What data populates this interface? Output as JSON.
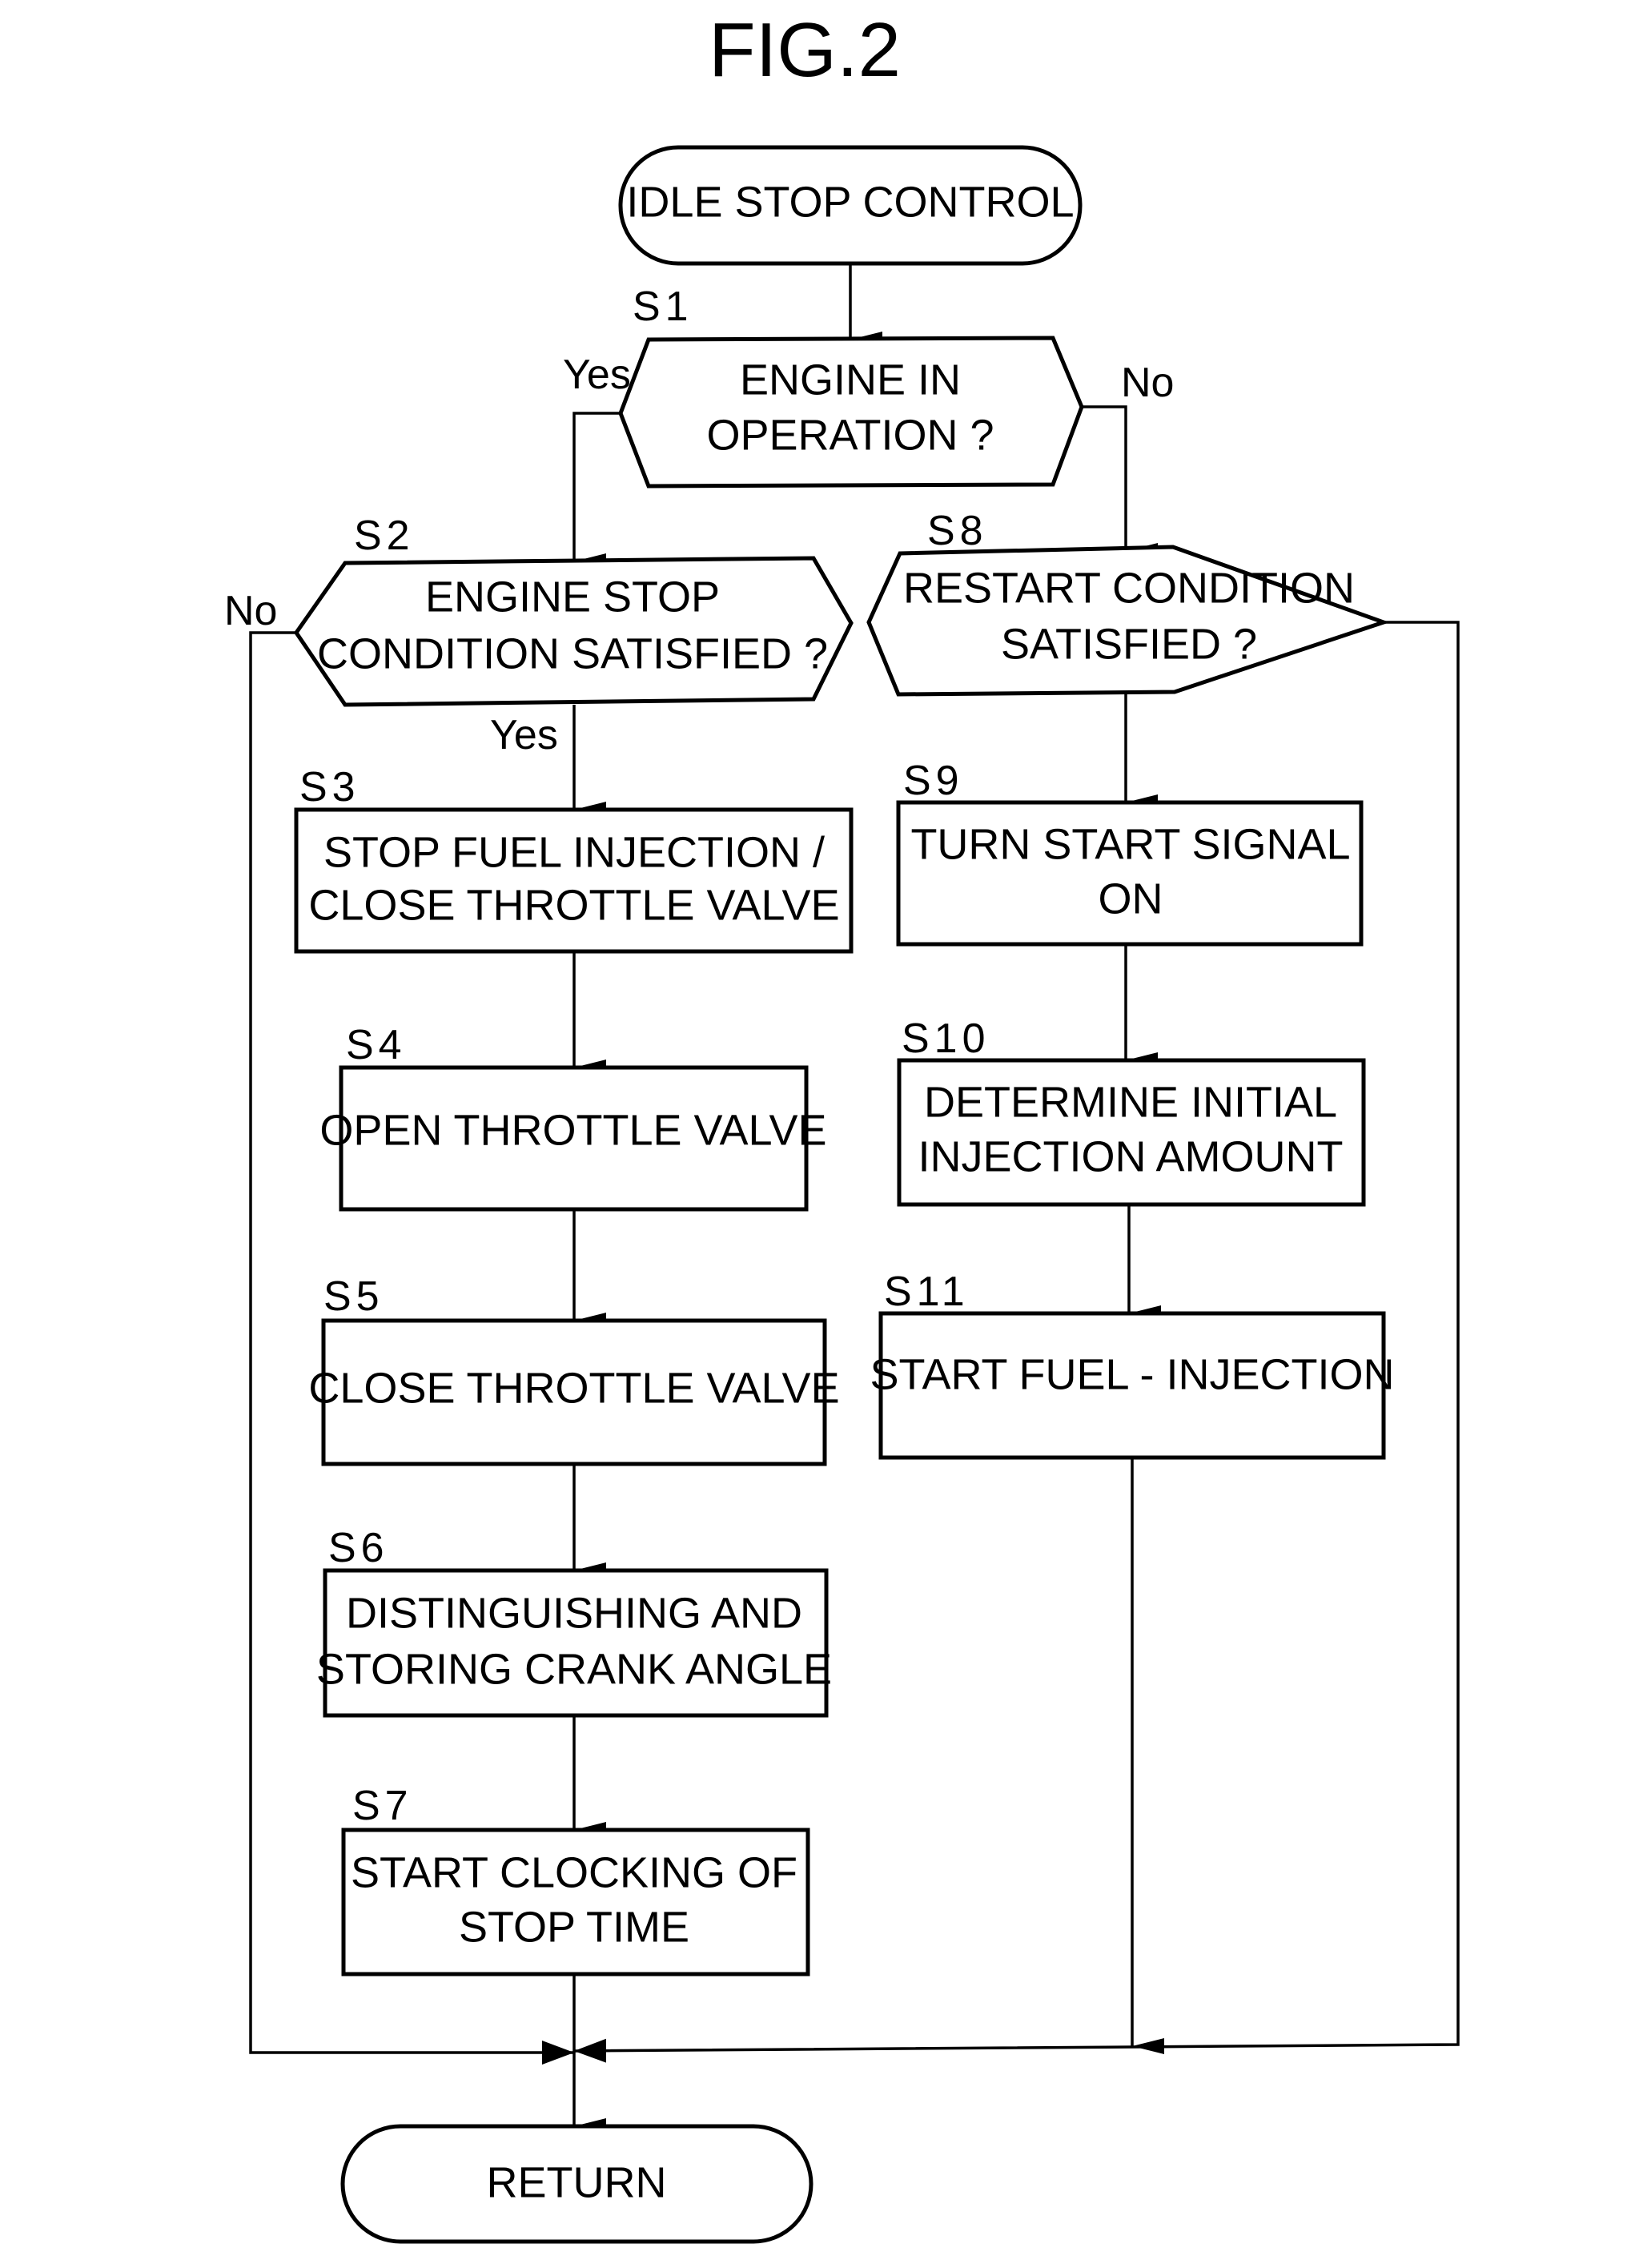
{
  "figure": {
    "title": "FIG.2",
    "start": "IDLE STOP CONTROL",
    "end": "RETURN"
  },
  "steps": {
    "s1": {
      "id": "S1",
      "type": "decision",
      "lines": [
        "ENGINE IN",
        "OPERATION ?"
      ],
      "yes_label": "Yes",
      "no_label": "No"
    },
    "s2": {
      "id": "S2",
      "type": "decision",
      "lines": [
        "ENGINE STOP",
        "CONDITION SATISFIED ?"
      ],
      "yes_label": "Yes",
      "no_label": "No"
    },
    "s3": {
      "id": "S3",
      "type": "process",
      "lines": [
        "STOP FUEL INJECTION /",
        "CLOSE THROTTLE VALVE"
      ]
    },
    "s4": {
      "id": "S4",
      "type": "process",
      "lines": [
        "OPEN THROTTLE VALVE"
      ]
    },
    "s5": {
      "id": "S5",
      "type": "process",
      "lines": [
        "CLOSE THROTTLE VALVE"
      ]
    },
    "s6": {
      "id": "S6",
      "type": "process",
      "lines": [
        "DISTINGUISHING AND",
        "STORING CRANK ANGLE"
      ]
    },
    "s7": {
      "id": "S7",
      "type": "process",
      "lines": [
        "START CLOCKING OF",
        "STOP TIME"
      ]
    },
    "s8": {
      "id": "S8",
      "type": "decision",
      "lines": [
        "RESTART CONDITION",
        "SATISFIED ?"
      ]
    },
    "s9": {
      "id": "S9",
      "type": "process",
      "lines": [
        "TURN START SIGNAL",
        "ON"
      ]
    },
    "s10": {
      "id": "S10",
      "type": "process",
      "lines": [
        "DETERMINE INITIAL",
        "INJECTION AMOUNT"
      ]
    },
    "s11": {
      "id": "S11",
      "type": "process",
      "lines": [
        "START FUEL - INJECTION"
      ]
    }
  },
  "flow": [
    {
      "from": "start",
      "to": "S1"
    },
    {
      "from": "S1",
      "to": "S2",
      "label": "Yes"
    },
    {
      "from": "S1",
      "to": "S8",
      "label": "No"
    },
    {
      "from": "S2",
      "to": "S3",
      "label": "Yes"
    },
    {
      "from": "S2",
      "to": "return",
      "label": "No"
    },
    {
      "from": "S3",
      "to": "S4"
    },
    {
      "from": "S4",
      "to": "S5"
    },
    {
      "from": "S5",
      "to": "S6"
    },
    {
      "from": "S6",
      "to": "S7"
    },
    {
      "from": "S7",
      "to": "return"
    },
    {
      "from": "S8",
      "to": "S9"
    },
    {
      "from": "S8",
      "to": "return"
    },
    {
      "from": "S9",
      "to": "S10"
    },
    {
      "from": "S10",
      "to": "S11"
    },
    {
      "from": "S11",
      "to": "return"
    }
  ]
}
